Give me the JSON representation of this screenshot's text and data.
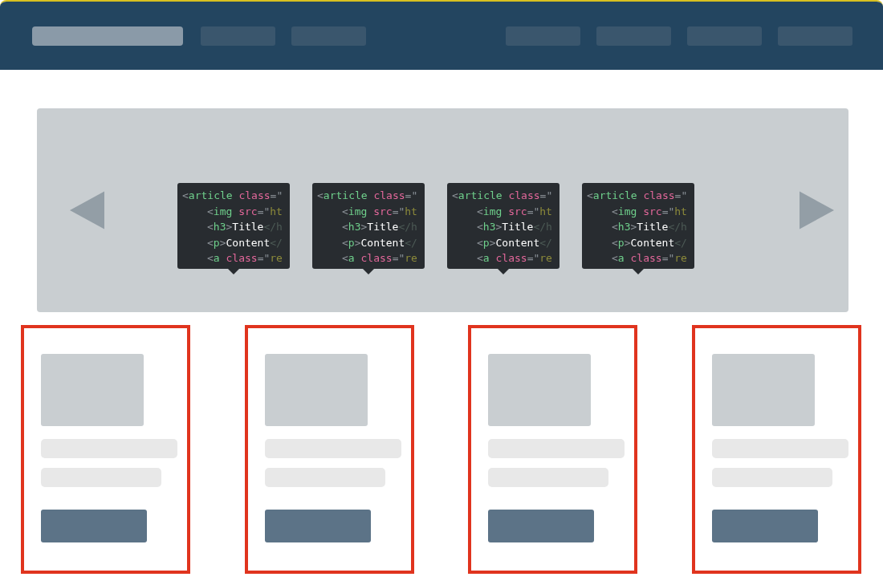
{
  "slides": [
    {
      "kind": "card",
      "code": [
        {
          "tokens": [
            {
              "kind": "punct",
              "text": "<"
            },
            {
              "kind": "tag",
              "text": "article"
            },
            {
              "kind": "attr",
              "text": " class"
            },
            {
              "kind": "punct",
              "text": "=\""
            }
          ],
          "children": [
            {
              "tokens": [
                {
                  "kind": "punct",
                  "text": "<"
                },
                {
                  "kind": "tag",
                  "text": "img"
                },
                {
                  "kind": "attr",
                  "text": " src"
                },
                {
                  "kind": "punct",
                  "text": "=\""
                },
                {
                  "kind": "string",
                  "text": "ht"
                }
              ]
            },
            {
              "tokens": [
                {
                  "kind": "punct",
                  "text": "<"
                },
                {
                  "kind": "tag",
                  "text": "h3"
                },
                {
                  "kind": "punct",
                  "text": ">"
                },
                {
                  "kind": "text",
                  "text": "Title"
                },
                {
                  "kind": "fade",
                  "text": "</h"
                }
              ]
            },
            {
              "tokens": [
                {
                  "kind": "punct",
                  "text": "<"
                },
                {
                  "kind": "tag",
                  "text": "p"
                },
                {
                  "kind": "punct",
                  "text": ">"
                },
                {
                  "kind": "text",
                  "text": "Content"
                },
                {
                  "kind": "fade",
                  "text": "</"
                }
              ]
            },
            {
              "tokens": [
                {
                  "kind": "punct",
                  "text": "<"
                },
                {
                  "kind": "tag",
                  "text": "a"
                },
                {
                  "kind": "attr",
                  "text": " class"
                },
                {
                  "kind": "punct",
                  "text": "=\""
                },
                {
                  "kind": "string",
                  "text": "re"
                }
              ]
            }
          ]
        }
      ]
    },
    {
      "kind": "card",
      "code": [
        {
          "tokens": [
            {
              "kind": "punct",
              "text": "<"
            },
            {
              "kind": "tag",
              "text": "article"
            },
            {
              "kind": "attr",
              "text": " class"
            },
            {
              "kind": "punct",
              "text": "=\""
            }
          ],
          "children": [
            {
              "tokens": [
                {
                  "kind": "punct",
                  "text": "<"
                },
                {
                  "kind": "tag",
                  "text": "img"
                },
                {
                  "kind": "attr",
                  "text": " src"
                },
                {
                  "kind": "punct",
                  "text": "=\""
                },
                {
                  "kind": "string",
                  "text": "ht"
                }
              ]
            },
            {
              "tokens": [
                {
                  "kind": "punct",
                  "text": "<"
                },
                {
                  "kind": "tag",
                  "text": "h3"
                },
                {
                  "kind": "punct",
                  "text": ">"
                },
                {
                  "kind": "text",
                  "text": "Title"
                },
                {
                  "kind": "fade",
                  "text": "</h"
                }
              ]
            },
            {
              "tokens": [
                {
                  "kind": "punct",
                  "text": "<"
                },
                {
                  "kind": "tag",
                  "text": "p"
                },
                {
                  "kind": "punct",
                  "text": ">"
                },
                {
                  "kind": "text",
                  "text": "Content"
                },
                {
                  "kind": "fade",
                  "text": "</"
                }
              ]
            },
            {
              "tokens": [
                {
                  "kind": "punct",
                  "text": "<"
                },
                {
                  "kind": "tag",
                  "text": "a"
                },
                {
                  "kind": "attr",
                  "text": " class"
                },
                {
                  "kind": "punct",
                  "text": "=\""
                },
                {
                  "kind": "string",
                  "text": "re"
                }
              ]
            }
          ]
        }
      ]
    },
    {
      "kind": "card",
      "code": [
        {
          "tokens": [
            {
              "kind": "punct",
              "text": "<"
            },
            {
              "kind": "tag",
              "text": "article"
            },
            {
              "kind": "attr",
              "text": " class"
            },
            {
              "kind": "punct",
              "text": "=\""
            }
          ],
          "children": [
            {
              "tokens": [
                {
                  "kind": "punct",
                  "text": "<"
                },
                {
                  "kind": "tag",
                  "text": "img"
                },
                {
                  "kind": "attr",
                  "text": " src"
                },
                {
                  "kind": "punct",
                  "text": "=\""
                },
                {
                  "kind": "string",
                  "text": "ht"
                }
              ]
            },
            {
              "tokens": [
                {
                  "kind": "punct",
                  "text": "<"
                },
                {
                  "kind": "tag",
                  "text": "h3"
                },
                {
                  "kind": "punct",
                  "text": ">"
                },
                {
                  "kind": "text",
                  "text": "Title"
                },
                {
                  "kind": "fade",
                  "text": "</h"
                }
              ]
            },
            {
              "tokens": [
                {
                  "kind": "punct",
                  "text": "<"
                },
                {
                  "kind": "tag",
                  "text": "p"
                },
                {
                  "kind": "punct",
                  "text": ">"
                },
                {
                  "kind": "text",
                  "text": "Content"
                },
                {
                  "kind": "fade",
                  "text": "</"
                }
              ]
            },
            {
              "tokens": [
                {
                  "kind": "punct",
                  "text": "<"
                },
                {
                  "kind": "tag",
                  "text": "a"
                },
                {
                  "kind": "attr",
                  "text": " class"
                },
                {
                  "kind": "punct",
                  "text": "=\""
                },
                {
                  "kind": "string",
                  "text": "re"
                }
              ]
            }
          ]
        }
      ]
    },
    {
      "kind": "card",
      "code": [
        {
          "tokens": [
            {
              "kind": "punct",
              "text": "<"
            },
            {
              "kind": "tag",
              "text": "article"
            },
            {
              "kind": "attr",
              "text": " class"
            },
            {
              "kind": "punct",
              "text": "=\""
            }
          ],
          "children": [
            {
              "tokens": [
                {
                  "kind": "punct",
                  "text": "<"
                },
                {
                  "kind": "tag",
                  "text": "img"
                },
                {
                  "kind": "attr",
                  "text": " src"
                },
                {
                  "kind": "punct",
                  "text": "=\""
                },
                {
                  "kind": "string",
                  "text": "ht"
                }
              ]
            },
            {
              "tokens": [
                {
                  "kind": "punct",
                  "text": "<"
                },
                {
                  "kind": "tag",
                  "text": "h3"
                },
                {
                  "kind": "punct",
                  "text": ">"
                },
                {
                  "kind": "text",
                  "text": "Title"
                },
                {
                  "kind": "fade",
                  "text": "</h"
                }
              ]
            },
            {
              "tokens": [
                {
                  "kind": "punct",
                  "text": "<"
                },
                {
                  "kind": "tag",
                  "text": "p"
                },
                {
                  "kind": "punct",
                  "text": ">"
                },
                {
                  "kind": "text",
                  "text": "Content"
                },
                {
                  "kind": "fade",
                  "text": "</"
                }
              ]
            },
            {
              "tokens": [
                {
                  "kind": "punct",
                  "text": "<"
                },
                {
                  "kind": "tag",
                  "text": "a"
                },
                {
                  "kind": "attr",
                  "text": " class"
                },
                {
                  "kind": "punct",
                  "text": "=\""
                },
                {
                  "kind": "string",
                  "text": "re"
                }
              ]
            }
          ]
        }
      ]
    }
  ]
}
